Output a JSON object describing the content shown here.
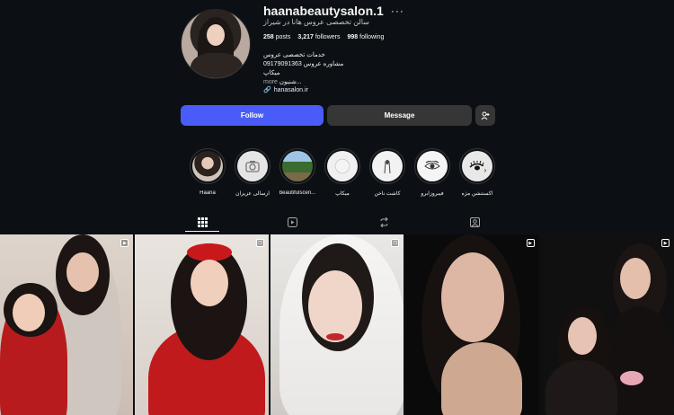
{
  "profile": {
    "username": "haanabeautysalon.1",
    "more_label": "···",
    "display_name": "سالن تخصصی عروس هانا در شیراز",
    "stats": [
      {
        "value": "258",
        "label": "posts"
      },
      {
        "value": "3,217",
        "label": "followers"
      },
      {
        "value": "998",
        "label": "following"
      }
    ],
    "bio_lines": [
      "خدمات تخصصی عروس",
      "مشاوره عروس 09179091363",
      "میکاپ",
      "...شنیون"
    ],
    "bio_more": "more",
    "link": "hanasalon.ir"
  },
  "actions": {
    "follow": "Follow",
    "message": "Message",
    "suggest_icon": "add-user-icon"
  },
  "highlights": [
    {
      "label": "Haana",
      "icon": "portrait"
    },
    {
      "label": "ارسالی عزیزان",
      "icon": "camera-icon"
    },
    {
      "label": "beautifulscen...",
      "icon": "landscape"
    },
    {
      "label": "میکاپ",
      "icon": "makeup"
    },
    {
      "label": "کاشت ناخن",
      "icon": "nail"
    },
    {
      "label": "فیبروزابرو",
      "icon": "eye"
    },
    {
      "label": "اکستنشن مژه",
      "icon": "lash"
    }
  ],
  "tabs": [
    {
      "name": "posts",
      "icon": "grid-icon"
    },
    {
      "name": "reels",
      "icon": "reels-icon"
    },
    {
      "name": "reposts",
      "icon": "repost-icon"
    },
    {
      "name": "tagged",
      "icon": "tagged-icon"
    }
  ],
  "colors": {
    "background": "#0c1014",
    "follow_button": "#4a5cf7",
    "secondary_button": "#363636",
    "text": "#f5f5f5"
  },
  "posts": [
    {
      "type": "reel",
      "icon": "reel-icon"
    },
    {
      "type": "carousel",
      "icon": "carousel-icon"
    },
    {
      "type": "carousel",
      "icon": "carousel-icon"
    },
    {
      "type": "reel",
      "icon": "reel-icon"
    },
    {
      "type": "reel",
      "icon": "reel-icon"
    }
  ]
}
